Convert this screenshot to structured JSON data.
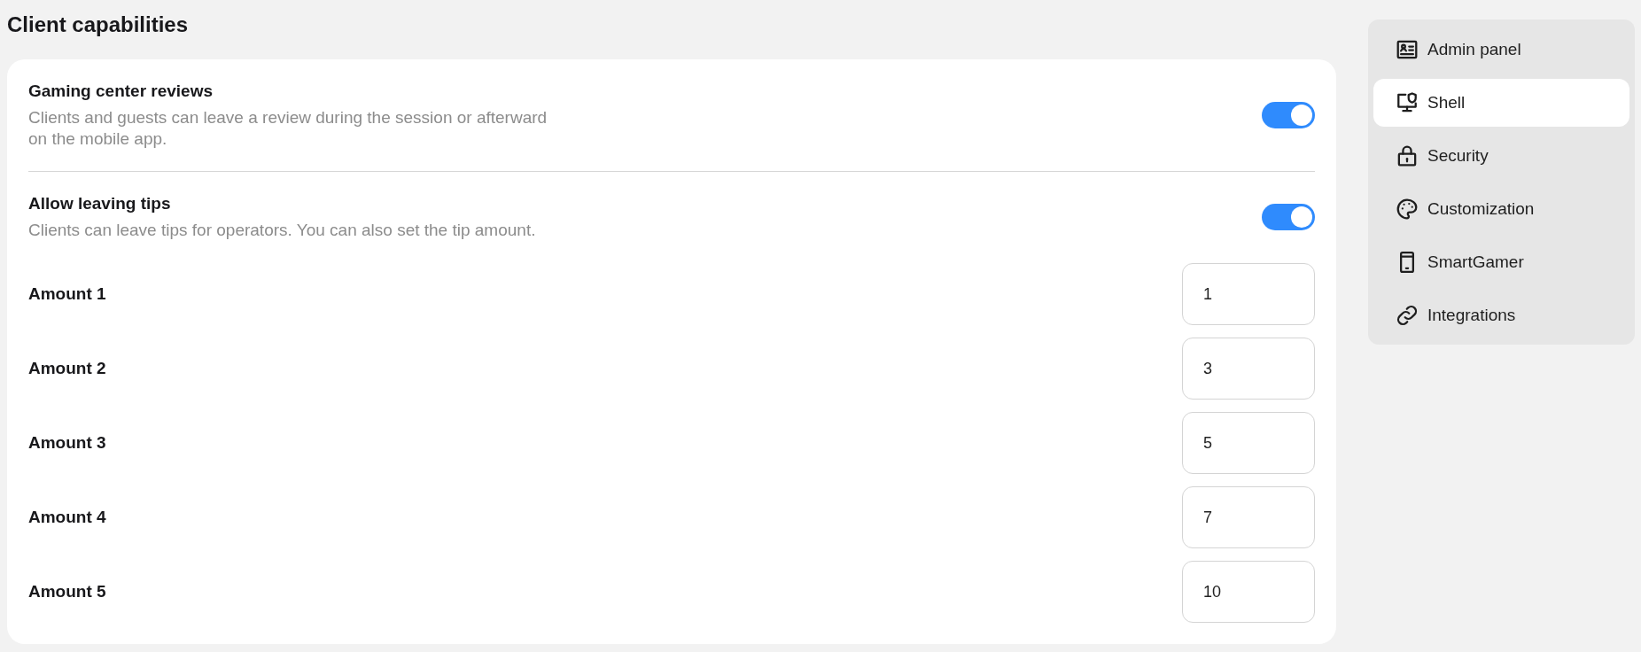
{
  "page": {
    "title": "Client capabilities"
  },
  "settings": [
    {
      "title": "Gaming center reviews",
      "description": "Clients and guests can leave a review during the session or afterward on the mobile app.",
      "on": true
    },
    {
      "title": "Allow leaving tips",
      "description": "Clients can leave tips for operators. You can also set the tip amount.",
      "on": true
    }
  ],
  "amounts": [
    {
      "label": "Amount 1",
      "value": "1"
    },
    {
      "label": "Amount 2",
      "value": "3"
    },
    {
      "label": "Amount 3",
      "value": "5"
    },
    {
      "label": "Amount 4",
      "value": "7"
    },
    {
      "label": "Amount 5",
      "value": "10"
    }
  ],
  "sidebar": {
    "items": [
      {
        "label": "Admin panel",
        "selected": false
      },
      {
        "label": "Shell",
        "selected": true
      },
      {
        "label": "Security",
        "selected": false
      },
      {
        "label": "Customization",
        "selected": false
      },
      {
        "label": "SmartGamer",
        "selected": false
      },
      {
        "label": "Integrations",
        "selected": false
      }
    ]
  }
}
